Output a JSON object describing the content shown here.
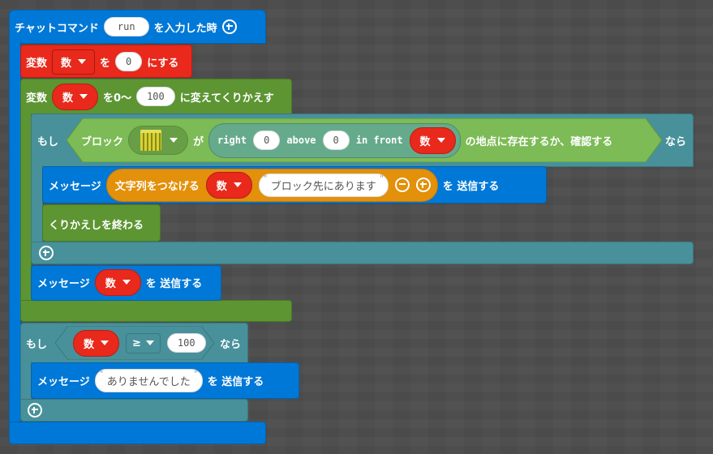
{
  "hat": {
    "prefix": "チャットコマンド",
    "command": "run",
    "suffix": "を入力した時",
    "add_icon": "plus-circle-icon"
  },
  "set_var": {
    "label": "変数",
    "var": "数",
    "to": "を",
    "value": "0",
    "suffix": "にする"
  },
  "loop": {
    "label": "変数",
    "var": "数",
    "from": "を0～",
    "to_value": "100",
    "suffix": "に変えてくりかえす"
  },
  "if1": {
    "label": "もし",
    "block_label": "ブロック",
    "block_icon": "melon-block-icon",
    "ga": "が",
    "pos": {
      "right_label": "right",
      "right_value": "0",
      "above_label": "above",
      "above_value": "0",
      "front_label": "in front",
      "front_var": "数"
    },
    "check_suffix": "の地点に存在するか、確認する",
    "then": "なら",
    "msg": {
      "label": "メッセージ",
      "join_label": "文字列をつなげる",
      "join_var": "数",
      "join_text": "ブロック先にあります",
      "send": "を 送信する"
    },
    "break_label": "くりかえしを終わる"
  },
  "msg2": {
    "label": "メッセージ",
    "var": "数",
    "send": "を 送信する"
  },
  "if2": {
    "label": "もし",
    "var": "数",
    "op": "≥",
    "value": "100",
    "then": "なら",
    "msg": {
      "label": "メッセージ",
      "text": "ありませんでした",
      "send": "を 送信する"
    }
  },
  "colors": {
    "events": "#0078d7",
    "variables": "#e8291c",
    "loops": "#5c9532",
    "logic": "#48919a",
    "blocks": "#7cbb55",
    "text": "#e3900b",
    "background": "#4e4e4e"
  }
}
